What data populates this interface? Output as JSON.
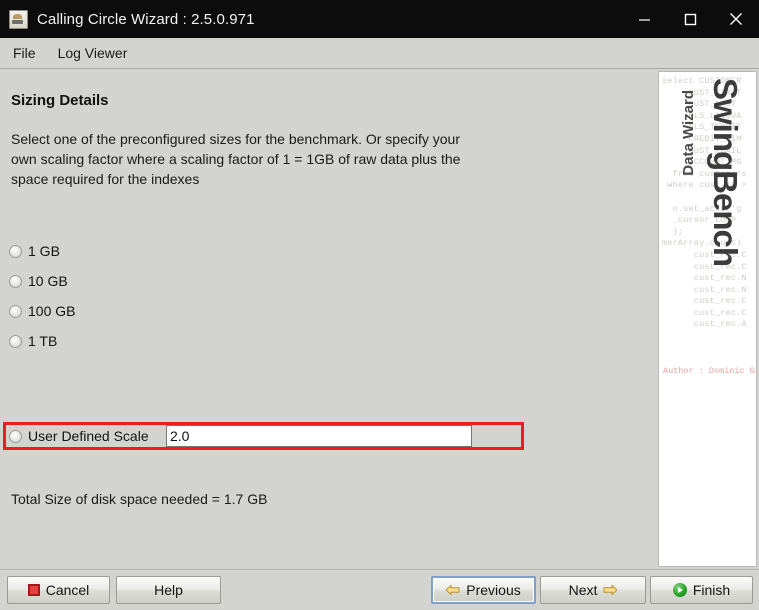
{
  "window": {
    "title": "Calling Circle Wizard : 2.5.0.971",
    "app_icon": "wizard-icon",
    "controls": {
      "minimize": "minimize-icon",
      "maximize": "maximize-icon",
      "close": "close-icon"
    }
  },
  "menubar": {
    "items": [
      {
        "label": "File"
      },
      {
        "label": "Log Viewer"
      }
    ]
  },
  "page": {
    "title": "Sizing Details",
    "description": "Select one of the preconfigured sizes for the benchmark. Or specify your own scaling factor where a scaling factor of 1 = 1GB of raw data plus the space required for the indexes",
    "total_size": "Total Size of disk space needed = 1.7 GB"
  },
  "sizing_options": [
    {
      "label": "1 GB",
      "selected": false
    },
    {
      "label": "10 GB",
      "selected": false
    },
    {
      "label": "100 GB",
      "selected": false
    },
    {
      "label": "1 TB",
      "selected": false
    },
    {
      "label": "User Defined Scale",
      "selected": true
    }
  ],
  "user_scale_input": {
    "value": "2.0",
    "placeholder": ""
  },
  "highlight": {
    "color": "#f01c1c"
  },
  "sidebar": {
    "brand": "SwingBench",
    "subtitle": "Data Wizard",
    "author": "Author : Dominic Giles",
    "code_snippet": "select CUSTOMER\n     CUST_FIRST\n     CUST_LAST\n     NLS_LANGUA\n     NLS_TERRIT\n     CREDIT_LIM\n     CUST_EMAIL\n     ACCOUNT_MG\n  from customers\n where cust_id >\n\n  o.set_acro('g\n  _cursor LOOP\n  );\nmerArray.count)\n      cust_rec.C\n      cust_rec.C\n      cust_rec.N\n      cust_rec.N\n      cust_rec.C\n      cust_rec.C\n      cust_rec.A"
  },
  "buttons": {
    "cancel": {
      "label": "Cancel",
      "icon": "stop-square-icon",
      "focused": false
    },
    "help": {
      "label": "Help",
      "icon": "",
      "focused": false
    },
    "previous": {
      "label": "Previous",
      "icon": "arrow-left-icon",
      "focused": true
    },
    "next": {
      "label": "Next",
      "icon": "arrow-right-icon",
      "focused": false
    },
    "finish": {
      "label": "Finish",
      "icon": "play-circle-icon",
      "focused": false
    }
  }
}
